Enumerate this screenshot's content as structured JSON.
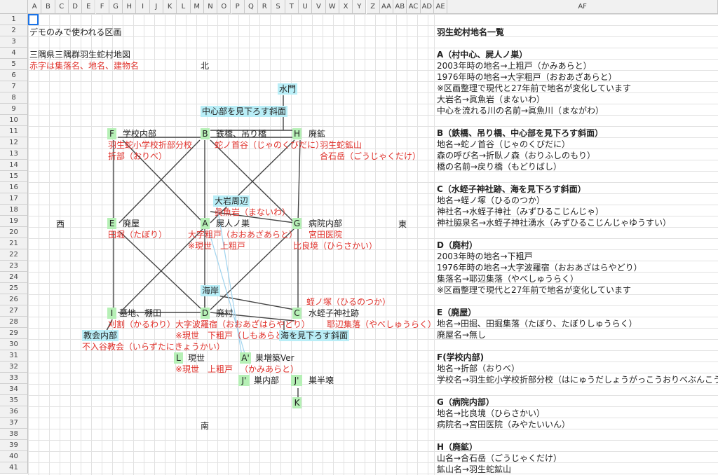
{
  "columns": [
    "A",
    "B",
    "C",
    "D",
    "E",
    "F",
    "G",
    "H",
    "I",
    "J",
    "K",
    "L",
    "M",
    "N",
    "O",
    "P",
    "Q",
    "R",
    "S",
    "T",
    "U",
    "V",
    "W",
    "X",
    "Y",
    "Z",
    "AA",
    "AB",
    "AC",
    "AD",
    "AE",
    "AF"
  ],
  "rows": [
    "1",
    "2",
    "3",
    "4",
    "5",
    "6",
    "7",
    "8",
    "9",
    "10",
    "11",
    "12",
    "13",
    "14",
    "15",
    "16",
    "17",
    "18",
    "19",
    "20",
    "21",
    "22",
    "23",
    "24",
    "25",
    "26",
    "27",
    "28",
    "29",
    "30",
    "31",
    "32",
    "33",
    "34",
    "35",
    "36",
    "37",
    "38",
    "39",
    "40",
    "41"
  ],
  "left": {
    "demo_note": "デモのみで使われる区画",
    "map_title": "三隅県三隅群羽生蛇村地図",
    "legend_red": "赤字は集落名、地名、建物名",
    "north": "北",
    "south": "南",
    "west": "西",
    "east": "東"
  },
  "nodes": {
    "suimon": "水門",
    "chushin_slope": "中心部を見下ろす斜面",
    "F": "F",
    "F_label": "学校内部",
    "F_red1": "羽生蛇小学校折部分校",
    "F_red2": "折部（おりべ）",
    "B": "B",
    "B_label": "鉄橋、吊り橋",
    "B_red": "蛇ノ首谷（じゃのくびだに）",
    "H": "H",
    "H_label": "廃鉱",
    "H_red1": "羽生蛇鉱山",
    "H_red2": "合石岳（ごうじゃくだけ）",
    "oiwa": "大岩周辺",
    "oiwa_red": "眞魚岩（まないわ）",
    "E": "E",
    "E_label": "廃屋",
    "E_red": "田堀（たぼり）",
    "A": "A",
    "A_label": "屍人ノ巣",
    "A_red1": "大字粗戸（おおあざあらと）",
    "A_red2": "※現世　上粗戸",
    "G": "G",
    "G_label": "病院内部",
    "G_red1": "宮田医院",
    "G_red2": "比良境（ひらさかい）",
    "kaigan": "海岸",
    "C_red_top": "蛭ノ塚（ひるのつか）",
    "I": "I",
    "I_label": "墓地、棚田",
    "I_red": "刈割（かるわり）",
    "D": "D",
    "D_label": "廃村",
    "D_red1": "大字波羅宿（おおあざはらやどり）",
    "D_red2": "※現世　下粗戸（しもあらと）",
    "C": "C",
    "C_label": "水蛭子神社跡",
    "C_red": "耶辺集落（やべしゅうらく）",
    "umi_slope": "海を見下ろす斜面",
    "church": "教会内部",
    "church_red": "不入谷教会（いらずたにきょうかい）",
    "L": "L",
    "L_label": "現世",
    "L_red": "※現世　上粗戸",
    "Aprime": "A'",
    "Aprime_label": "巣増築Ver",
    "Aprime_red": "（かみあらと）",
    "Jprime": "J'",
    "Jprime_label": "巣内部",
    "Jpp": "J'",
    "Jpp_label": "巣半壊",
    "K": "K"
  },
  "right": {
    "title": "羽生蛇村地名一覧",
    "lines": [
      {
        "text": "A（村中心、屍人ノ巣）",
        "bold": true
      },
      {
        "text": "2003年時の地名→上粗戸（かみあらと）",
        "bold": false
      },
      {
        "text": "1976年時の地名→大字粗戸（おおあざあらと）",
        "bold": false
      },
      {
        "text": "※区画整理で現代と27年前で地名が変化しています",
        "bold": false
      },
      {
        "text": "大岩名→眞魚岩（まないわ）",
        "bold": false
      },
      {
        "text": "中心を流れる川の名前→眞魚川（まながわ）",
        "bold": false
      },
      {
        "text": "",
        "bold": false
      },
      {
        "text": "B（鉄橋、吊り橋、中心部を見下ろす斜面）",
        "bold": true
      },
      {
        "text": "地名→蛇ノ首谷（じゃのくびだに）",
        "bold": false
      },
      {
        "text": "森の呼び名→折臥ノ森（おりふしのもり）",
        "bold": false
      },
      {
        "text": "橋の名前→戻り橋（もどりばし）",
        "bold": false
      },
      {
        "text": "",
        "bold": false
      },
      {
        "text": "C（水蛭子神社跡、海を見下ろす斜面）",
        "bold": true
      },
      {
        "text": "地名→蛭ノ塚（ひるのつか）",
        "bold": false
      },
      {
        "text": "神社名→水蛭子神社（みずひるこじんじゃ）",
        "bold": false
      },
      {
        "text": "神社脇泉名→水蛭子神社湧水（みずひるこじんじゃゆうすい）",
        "bold": false
      },
      {
        "text": "",
        "bold": false
      },
      {
        "text": "D（廃村）",
        "bold": true
      },
      {
        "text": "2003年時の地名→下粗戸",
        "bold": false
      },
      {
        "text": "1976年時の地名→大字波羅宿（おおあざはらやどり）",
        "bold": false
      },
      {
        "text": "集落名→耶辺集落（やべしゅうらく）",
        "bold": false
      },
      {
        "text": "※区画整理で現代と27年前で地名が変化しています",
        "bold": false
      },
      {
        "text": "",
        "bold": false
      },
      {
        "text": "E（廃屋）",
        "bold": true
      },
      {
        "text": "地名→田掘、田掘集落（たぼり、たぼりしゅうらく）",
        "bold": false
      },
      {
        "text": "廃屋名→無し",
        "bold": false
      },
      {
        "text": "",
        "bold": false
      },
      {
        "text": "F(学校内部)",
        "bold": true
      },
      {
        "text": "地名→折部（おりべ）",
        "bold": false
      },
      {
        "text": "学校名→羽生蛇小学校折部分校（はにゅうだしょうがっこうおりべぶんこう）",
        "bold": false
      },
      {
        "text": "",
        "bold": false
      },
      {
        "text": "G（病院内部）",
        "bold": true
      },
      {
        "text": "地名→比良境（ひらさかい）",
        "bold": false
      },
      {
        "text": "病院名→宮田医院（みやたいいん）",
        "bold": false
      },
      {
        "text": "",
        "bold": false
      },
      {
        "text": "H（廃鉱）",
        "bold": true
      },
      {
        "text": "山名→合石岳（ごうじゃくだけ）",
        "bold": false
      },
      {
        "text": "鉱山名→羽生蛇鉱山",
        "bold": false
      }
    ]
  }
}
